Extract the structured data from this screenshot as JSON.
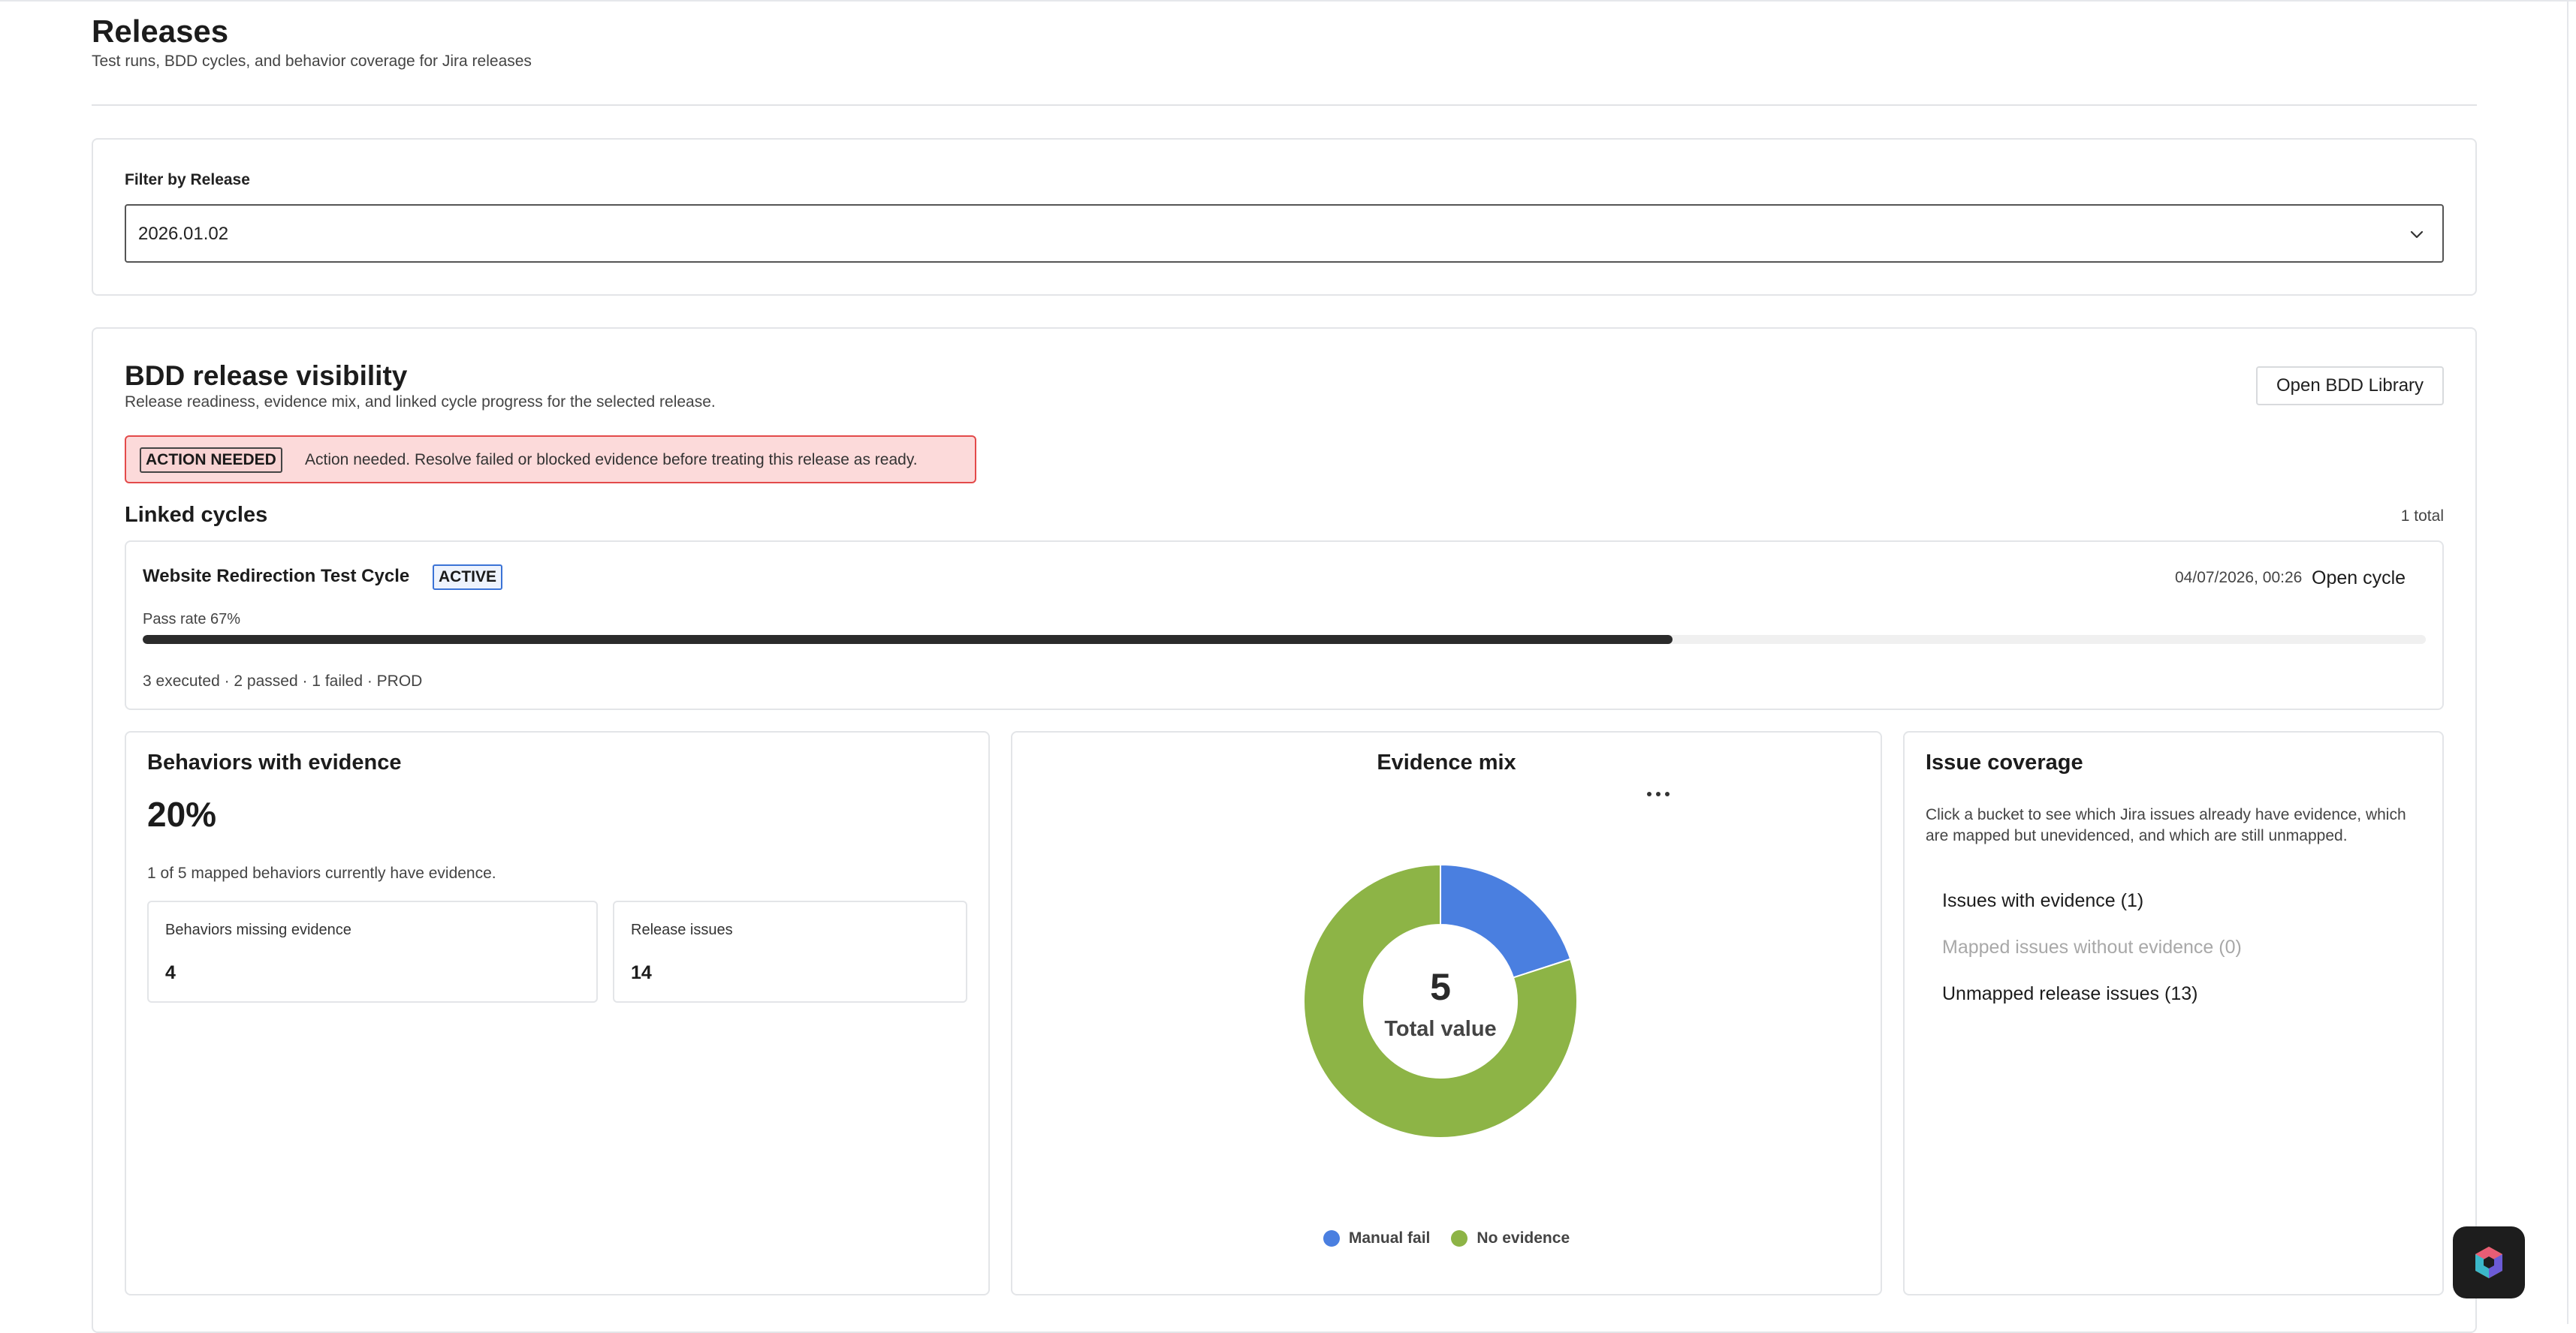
{
  "header": {
    "title": "Releases",
    "subtitle": "Test runs, BDD cycles, and behavior coverage for Jira releases"
  },
  "filter": {
    "label": "Filter by Release",
    "selected": "2026.01.02"
  },
  "bdd": {
    "title": "BDD release visibility",
    "subtitle": "Release readiness, evidence mix, and linked cycle progress for the selected release.",
    "open_library_label": "Open BDD Library",
    "alert": {
      "badge": "ACTION NEEDED",
      "text": "Action needed. Resolve failed or blocked evidence before treating this release as ready."
    },
    "linked_cycles": {
      "title": "Linked cycles",
      "count": "1 total",
      "items": [
        {
          "name": "Website Redirection Test Cycle",
          "status": "ACTIVE",
          "date": "04/07/2026, 00:26",
          "open_label": "Open cycle",
          "pass_rate_label": "Pass rate 67%",
          "pass_rate": 0.67,
          "meta": "3 executed · 2 passed · 1 failed · PROD"
        }
      ]
    }
  },
  "behaviors": {
    "title": "Behaviors with evidence",
    "percent": "20%",
    "note": "1 of 5 mapped behaviors currently have evidence.",
    "missing_label": "Behaviors missing evidence",
    "missing_value": "4",
    "issues_label": "Release issues",
    "issues_value": "14"
  },
  "evidence_mix": {
    "title": "Evidence mix",
    "total": "5",
    "total_label": "Total value",
    "colors": {
      "manual_fail": "#4a7fe0",
      "no_evidence": "#8db446"
    },
    "legend": [
      {
        "label": "Manual fail",
        "color": "#4a7fe0"
      },
      {
        "label": "No evidence",
        "color": "#8db446"
      }
    ]
  },
  "chart_data": {
    "type": "pie",
    "title": "Evidence mix",
    "categories": [
      "Manual fail",
      "No evidence"
    ],
    "values": [
      1,
      4
    ],
    "center_value": 5,
    "center_label": "Total value",
    "legend_position": "bottom"
  },
  "coverage": {
    "title": "Issue coverage",
    "description": "Click a bucket to see which Jira issues already have evidence, which are mapped but unevidenced, and which are still unmapped.",
    "buckets": [
      {
        "label": "Issues with evidence (1)",
        "disabled": false
      },
      {
        "label": "Mapped issues without evidence (0)",
        "disabled": true
      },
      {
        "label": "Unmapped release issues (13)",
        "disabled": false
      }
    ]
  },
  "fab": {
    "icon": "app-logo-icon"
  }
}
